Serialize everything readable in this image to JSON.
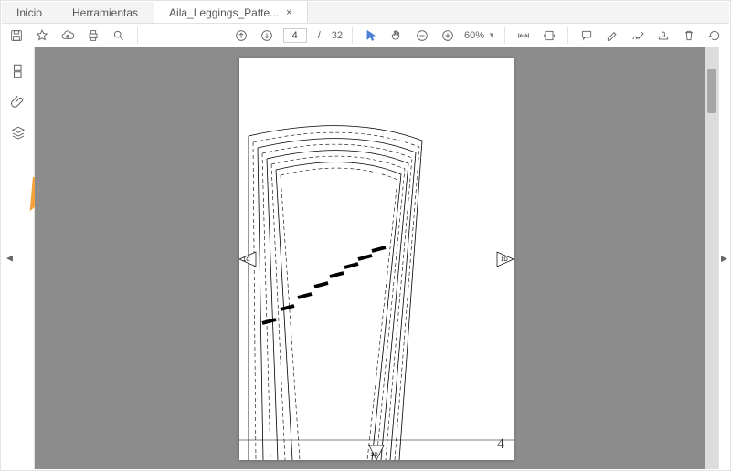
{
  "tabs": {
    "home": "Inicio",
    "tools": "Herramientas",
    "doc": "Aila_Leggings_Patte..."
  },
  "toolbar": {
    "page_current": "4",
    "page_sep": "/",
    "page_total": "32",
    "zoom": "60%"
  },
  "page": {
    "number": "4",
    "mark_left": "1C",
    "mark_right": "1D",
    "mark_bottom": "2D"
  },
  "icons": {
    "save": "save-icon",
    "star": "star-icon",
    "cloud": "cloud-upload-icon",
    "print": "print-icon",
    "search": "search-icon",
    "up": "arrow-up-circle-icon",
    "down": "arrow-down-circle-icon",
    "cursor": "cursor-icon",
    "hand": "hand-icon",
    "zoomout": "minus-circle-icon",
    "zoomin": "plus-circle-icon",
    "fitw": "fit-width-icon",
    "fitp": "fit-page-icon",
    "comment": "comment-icon",
    "highlight": "highlight-icon",
    "sign": "sign-icon",
    "stamp": "stamp-icon",
    "delete": "trash-icon",
    "rotate": "rotate-icon",
    "thumbs": "thumbnails-icon",
    "attach": "attachment-icon",
    "layers": "layers-icon"
  }
}
